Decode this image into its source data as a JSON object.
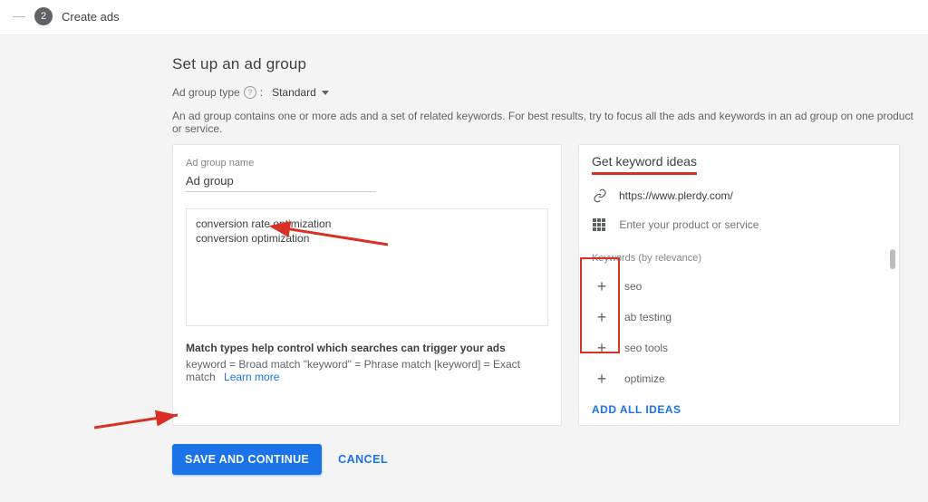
{
  "stepper": {
    "number": "2",
    "label": "Create ads"
  },
  "heading": "Set up an ad group",
  "type_row": {
    "label": "Ad group type",
    "value": "Standard"
  },
  "description": "An ad group contains one or more ads and a set of related keywords. For best results, try to focus all the ads and keywords in an ad group on one product or service.",
  "left_card": {
    "name_label": "Ad group name",
    "name_value": "Ad group",
    "keywords_text": "conversion rate optimization\nconversion optimization",
    "match_title": "Match types help control which searches can trigger your ads",
    "match_line": "keyword = Broad match   \"keyword\" = Phrase match   [keyword] = Exact match",
    "learn_more": "Learn more"
  },
  "right_card": {
    "title": "Get keyword ideas",
    "url": "https://www.plerdy.com/",
    "product_placeholder": "Enter your product or service",
    "list_header": "Keywords (by relevance)",
    "items": [
      {
        "label": "seo"
      },
      {
        "label": "ab testing"
      },
      {
        "label": "seo tools"
      },
      {
        "label": "optimize"
      }
    ],
    "add_all": "ADD ALL IDEAS"
  },
  "buttons": {
    "save": "SAVE AND CONTINUE",
    "cancel": "CANCEL"
  }
}
